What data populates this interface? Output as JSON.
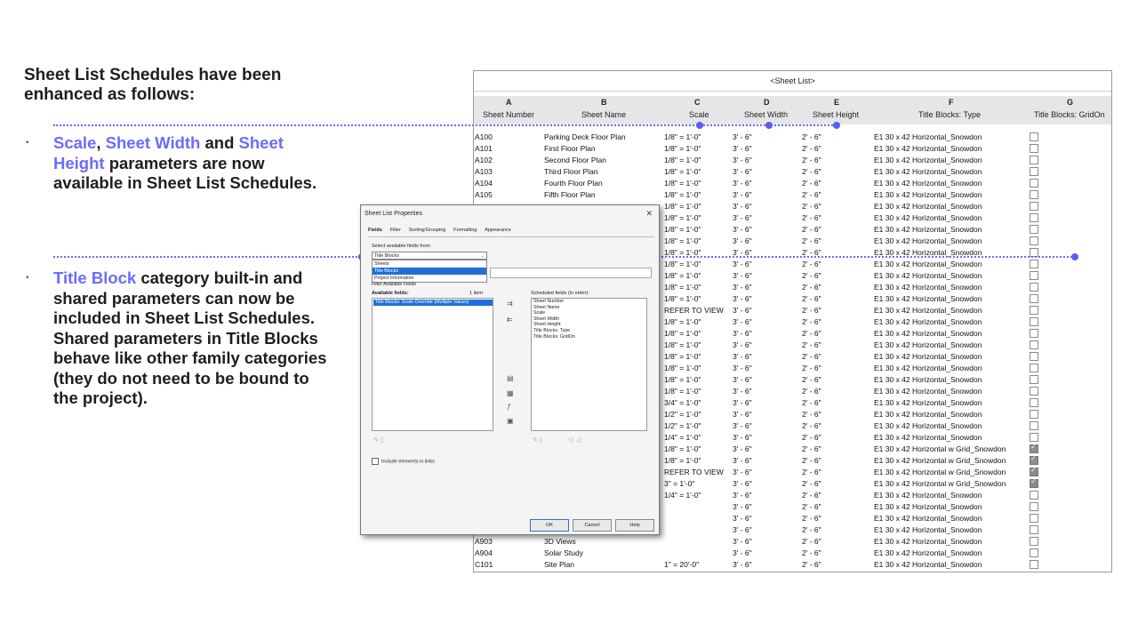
{
  "left": {
    "heading": "Sheet List Schedules have been enhanced as follows:",
    "bullet_marker": "▪",
    "bullet1": {
      "hl1": "Scale",
      "sep1": ", ",
      "hl2": "Sheet Width",
      "sep2": " and ",
      "hl3": "Sheet Height",
      "rest": " parameters are now available in Sheet List Schedules."
    },
    "bullet2": {
      "hl1": "Title Block",
      "rest": " category built-in and shared parameters can now be included in Sheet List Schedules. Shared parameters in Title Blocks behave like other family categories (they do not need to be bound to the project)."
    }
  },
  "schedule": {
    "title": "<Sheet List>",
    "columns": [
      {
        "letter": "A",
        "name": "Sheet Number"
      },
      {
        "letter": "B",
        "name": "Sheet Name"
      },
      {
        "letter": "C",
        "name": "Scale"
      },
      {
        "letter": "D",
        "name": "Sheet Width"
      },
      {
        "letter": "E",
        "name": "Sheet Height"
      },
      {
        "letter": "F",
        "name": "Title Blocks: Type"
      },
      {
        "letter": "G",
        "name": "Title Blocks: GridOn"
      }
    ],
    "rows": [
      {
        "num": "A100",
        "name": "Parking Deck Floor Plan",
        "scale": "1/8\" = 1'-0\"",
        "w": "3' - 6\"",
        "h": "2' - 6\"",
        "type": "E1 30 x 42 Horizontal_Snowdon",
        "grid": false
      },
      {
        "num": "A101",
        "name": "First Floor Plan",
        "scale": "1/8\" = 1'-0\"",
        "w": "3' - 6\"",
        "h": "2' - 6\"",
        "type": "E1 30 x 42 Horizontal_Snowdon",
        "grid": false
      },
      {
        "num": "A102",
        "name": "Second Floor Plan",
        "scale": "1/8\" = 1'-0\"",
        "w": "3' - 6\"",
        "h": "2' - 6\"",
        "type": "E1 30 x 42 Horizontal_Snowdon",
        "grid": false
      },
      {
        "num": "A103",
        "name": "Third Floor Plan",
        "scale": "1/8\" = 1'-0\"",
        "w": "3' - 6\"",
        "h": "2' - 6\"",
        "type": "E1 30 x 42 Horizontal_Snowdon",
        "grid": false
      },
      {
        "num": "A104",
        "name": "Fourth Floor Plan",
        "scale": "1/8\" = 1'-0\"",
        "w": "3' - 6\"",
        "h": "2' - 6\"",
        "type": "E1 30 x 42 Horizontal_Snowdon",
        "grid": false
      },
      {
        "num": "A105",
        "name": "Fifth Floor Plan",
        "scale": "1/8\" = 1'-0\"",
        "w": "3' - 6\"",
        "h": "2' - 6\"",
        "type": "E1 30 x 42 Horizontal_Snowdon",
        "grid": false
      },
      {
        "num": "",
        "name": "",
        "scale": "1/8\" = 1'-0\"",
        "w": "3' - 6\"",
        "h": "2' - 6\"",
        "type": "E1 30 x 42 Horizontal_Snowdon",
        "grid": false
      },
      {
        "num": "",
        "name": "",
        "scale": "1/8\" = 1'-0\"",
        "w": "3' - 6\"",
        "h": "2' - 6\"",
        "type": "E1 30 x 42 Horizontal_Snowdon",
        "grid": false
      },
      {
        "num": "",
        "name": "",
        "scale": "1/8\" = 1'-0\"",
        "w": "3' - 6\"",
        "h": "2' - 6\"",
        "type": "E1 30 x 42 Horizontal_Snowdon",
        "grid": false
      },
      {
        "num": "",
        "name": "",
        "scale": "1/8\" = 1'-0\"",
        "w": "3' - 6\"",
        "h": "2' - 6\"",
        "type": "E1 30 x 42 Horizontal_Snowdon",
        "grid": false
      },
      {
        "num": "",
        "name": "",
        "scale": "1/8\" = 1'-0\"",
        "w": "3' - 6\"",
        "h": "2' - 6\"",
        "type": "E1 30 x 42 Horizontal_Snowdon",
        "grid": false
      },
      {
        "num": "",
        "name": "",
        "scale": "1/8\" = 1'-0\"",
        "w": "3' - 6\"",
        "h": "2' - 6\"",
        "type": "E1 30 x 42 Horizontal_Snowdon",
        "grid": false
      },
      {
        "num": "",
        "name": "",
        "scale": "1/8\" = 1'-0\"",
        "w": "3' - 6\"",
        "h": "2' - 6\"",
        "type": "E1 30 x 42 Horizontal_Snowdon",
        "grid": false
      },
      {
        "num": "",
        "name": "",
        "scale": "1/8\" = 1'-0\"",
        "w": "3' - 6\"",
        "h": "2' - 6\"",
        "type": "E1 30 x 42 Horizontal_Snowdon",
        "grid": false
      },
      {
        "num": "",
        "name": "",
        "scale": "1/8\" = 1'-0\"",
        "w": "3' - 6\"",
        "h": "2' - 6\"",
        "type": "E1 30 x 42 Horizontal_Snowdon",
        "grid": false
      },
      {
        "num": "",
        "name": "",
        "scale": "REFER TO VIEW",
        "w": "3' - 6\"",
        "h": "2' - 6\"",
        "type": "E1 30 x 42 Horizontal_Snowdon",
        "grid": false
      },
      {
        "num": "",
        "name": "",
        "scale": "1/8\" = 1'-0\"",
        "w": "3' - 6\"",
        "h": "2' - 6\"",
        "type": "E1 30 x 42 Horizontal_Snowdon",
        "grid": false
      },
      {
        "num": "",
        "name": "",
        "scale": "1/8\" = 1'-0\"",
        "w": "3' - 6\"",
        "h": "2' - 6\"",
        "type": "E1 30 x 42 Horizontal_Snowdon",
        "grid": false
      },
      {
        "num": "",
        "name": "",
        "scale": "1/8\" = 1'-0\"",
        "w": "3' - 6\"",
        "h": "2' - 6\"",
        "type": "E1 30 x 42 Horizontal_Snowdon",
        "grid": false
      },
      {
        "num": "",
        "name": "",
        "scale": "1/8\" = 1'-0\"",
        "w": "3' - 6\"",
        "h": "2' - 6\"",
        "type": "E1 30 x 42 Horizontal_Snowdon",
        "grid": false
      },
      {
        "num": "",
        "name": "",
        "scale": "1/8\" = 1'-0\"",
        "w": "3' - 6\"",
        "h": "2' - 6\"",
        "type": "E1 30 x 42 Horizontal_Snowdon",
        "grid": false
      },
      {
        "num": "",
        "name": "",
        "scale": "1/8\" = 1'-0\"",
        "w": "3' - 6\"",
        "h": "2' - 6\"",
        "type": "E1 30 x 42 Horizontal_Snowdon",
        "grid": false
      },
      {
        "num": "",
        "name": "",
        "scale": "1/8\" = 1'-0\"",
        "w": "3' - 6\"",
        "h": "2' - 6\"",
        "type": "E1 30 x 42 Horizontal_Snowdon",
        "grid": false
      },
      {
        "num": "",
        "name": "",
        "scale": "3/4\" = 1'-0\"",
        "w": "3' - 6\"",
        "h": "2' - 6\"",
        "type": "E1 30 x 42 Horizontal_Snowdon",
        "grid": false
      },
      {
        "num": "",
        "name": "",
        "scale": "1/2\" = 1'-0\"",
        "w": "3' - 6\"",
        "h": "2' - 6\"",
        "type": "E1 30 x 42 Horizontal_Snowdon",
        "grid": false
      },
      {
        "num": "",
        "name": "",
        "scale": "1/2\" = 1'-0\"",
        "w": "3' - 6\"",
        "h": "2' - 6\"",
        "type": "E1 30 x 42 Horizontal_Snowdon",
        "grid": false
      },
      {
        "num": "",
        "name": "",
        "scale": "1/4\" = 1'-0\"",
        "w": "3' - 6\"",
        "h": "2' - 6\"",
        "type": "E1 30 x 42 Horizontal_Snowdon",
        "grid": false
      },
      {
        "num": "",
        "name": "",
        "scale": "1/8\" = 1'-0\"",
        "w": "3' - 6\"",
        "h": "2' - 6\"",
        "type": "E1 30 x 42 Horizontal w Grid_Snowdon",
        "grid": true
      },
      {
        "num": "",
        "name": "",
        "scale": "1/8\" = 1'-0\"",
        "w": "3' - 6\"",
        "h": "2' - 6\"",
        "type": "E1 30 x 42 Horizontal w Grid_Snowdon",
        "grid": true
      },
      {
        "num": "",
        "name": "",
        "scale": "REFER TO VIEW",
        "w": "3' - 6\"",
        "h": "2' - 6\"",
        "type": "E1 30 x 42 Horizontal w Grid_Snowdon",
        "grid": true
      },
      {
        "num": "",
        "name": "",
        "scale": "3\" = 1'-0\"",
        "w": "3' - 6\"",
        "h": "2' - 6\"",
        "type": "E1 30 x 42 Horizontal w Grid_Snowdon",
        "grid": true
      },
      {
        "num": "",
        "name": "",
        "scale": "1/4\" = 1'-0\"",
        "w": "3' - 6\"",
        "h": "2' - 6\"",
        "type": "E1 30 x 42 Horizontal_Snowdon",
        "grid": false
      },
      {
        "num": "",
        "name": "",
        "scale": "",
        "w": "3' - 6\"",
        "h": "2' - 6\"",
        "type": "E1 30 x 42 Horizontal_Snowdon",
        "grid": false
      },
      {
        "num": "",
        "name": "",
        "scale": "",
        "w": "3' - 6\"",
        "h": "2' - 6\"",
        "type": "E1 30 x 42 Horizontal_Snowdon",
        "grid": false
      },
      {
        "num": "",
        "name": "",
        "scale": "",
        "w": "3' - 6\"",
        "h": "2' - 6\"",
        "type": "E1 30 x 42 Horizontal_Snowdon",
        "grid": false
      },
      {
        "num": "A903",
        "name": "3D Views",
        "scale": "",
        "w": "3' - 6\"",
        "h": "2' - 6\"",
        "type": "E1 30 x 42 Horizontal_Snowdon",
        "grid": false
      },
      {
        "num": "A904",
        "name": "Solar Study",
        "scale": "",
        "w": "3' - 6\"",
        "h": "2' - 6\"",
        "type": "E1 30 x 42 Horizontal_Snowdon",
        "grid": false
      },
      {
        "num": "C101",
        "name": "Site Plan",
        "scale": "1\" = 20'-0\"",
        "w": "3' - 6\"",
        "h": "2' - 6\"",
        "type": "E1 30 x 42 Horizontal_Snowdon",
        "grid": false
      }
    ]
  },
  "dialog": {
    "title": "Sheet List Properties",
    "close": "✕",
    "tabs": [
      "Fields",
      "Filter",
      "Sorting/Grouping",
      "Formatting",
      "Appearance"
    ],
    "select_from_label": "Select available fields from:",
    "combo_value": "Title Blocks",
    "dropdown_options": [
      "Sheets",
      "Title Blocks",
      "Project Information"
    ],
    "filter_label": "Filter Available Fields",
    "available_label": "Available fields:",
    "available_count": "1 item",
    "available_items": [
      "Title Blocks: Scale Override (Multiple Values)"
    ],
    "scheduled_label": "Scheduled fields (in order):",
    "scheduled_items": [
      "Sheet Number",
      "Sheet Name",
      "Scale",
      "Sheet Width",
      "Sheet Height",
      "Title Blocks: Type",
      "Title Blocks: GridOn"
    ],
    "include_links": "Include elements in links",
    "ok": "OK",
    "cancel": "Cancel",
    "help": "Help"
  }
}
